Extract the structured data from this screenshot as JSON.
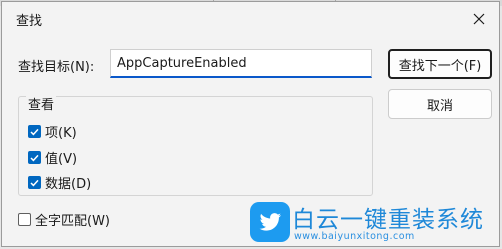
{
  "dialog": {
    "title": "查找",
    "find_label": "查找目标(N):",
    "find_value": "AppCaptureEnabled",
    "find_next_label": "查找下一个(F)",
    "cancel_label": "取消",
    "look_at": {
      "title": "查看",
      "options": [
        {
          "label": "项(K)",
          "checked": true
        },
        {
          "label": "值(V)",
          "checked": true
        },
        {
          "label": "数据(D)",
          "checked": true
        }
      ]
    },
    "whole_word": {
      "label": "全字匹配(W)",
      "checked": false
    }
  },
  "watermark": {
    "title": "白云一键重装系统",
    "url": "www.baiyunxitong.com",
    "icon": "twitter-bird-icon"
  },
  "colors": {
    "accent": "#0067c0",
    "focus_underline": "#0a58ca",
    "dialog_bg": "#f3f3f3",
    "watermark_blue": "#1e88d8"
  }
}
